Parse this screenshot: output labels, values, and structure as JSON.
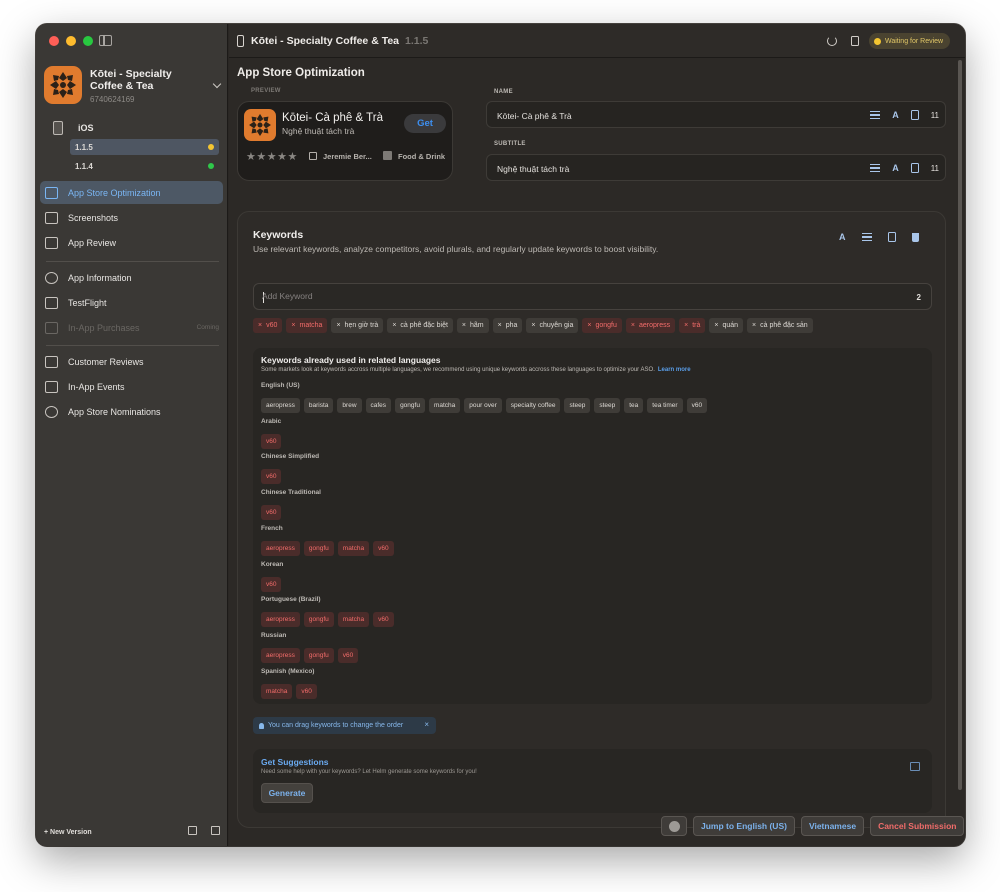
{
  "app": {
    "name": "Kōtei - Specialty Coffee & Tea",
    "id": "6740624169",
    "version": "1.1.5",
    "status": "Waiting for Review"
  },
  "sidebar": {
    "platform": "iOS",
    "versions": [
      {
        "label": "1.1.5",
        "dot": "#f3c531"
      },
      {
        "label": "1.1.4",
        "dot": "#2fc84a"
      }
    ],
    "nav": [
      {
        "label": "App Store Optimization",
        "icon": "magnifier-icon"
      },
      {
        "label": "Screenshots",
        "icon": "screenshots-icon"
      },
      {
        "label": "App Review",
        "icon": "app-review-icon"
      },
      {
        "label": "App Information",
        "icon": "info-icon"
      },
      {
        "label": "TestFlight",
        "icon": "testflight-icon"
      },
      {
        "label": "In-App Purchases",
        "icon": "purchases-icon",
        "badge": "Coming"
      },
      {
        "label": "Customer Reviews",
        "icon": "star-icon"
      },
      {
        "label": "In-App Events",
        "icon": "calendar-icon"
      },
      {
        "label": "App Store Nominations",
        "icon": "nomination-icon"
      }
    ],
    "new_version": "+ New Version"
  },
  "main": {
    "section_title": "App Store Optimization",
    "preview": {
      "label": "PREVIEW",
      "name": "Kōtei- Cà phê & Trà",
      "subtitle": "Nghệ thuật tách trà",
      "get": "Get",
      "stars": "★★★★★",
      "developer": "Jeremie Ber...",
      "category": "Food & Drink"
    },
    "name_field": {
      "label": "NAME",
      "value": "Kōtei- Cà phê & Trà",
      "count": "11"
    },
    "subtitle_field": {
      "label": "SUBTITLE",
      "value": "Nghệ thuật tách trà",
      "count": "11"
    },
    "keywords": {
      "title": "Keywords",
      "description": "Use relevant keywords, analyze competitors, avoid plurals, and regularly update keywords to boost visibility.",
      "placeholder": "Add Keyword",
      "count": "2",
      "chips": [
        {
          "label": "v60",
          "red": true
        },
        {
          "label": "matcha",
          "red": true
        },
        {
          "label": "hẹn giờ trà",
          "red": false
        },
        {
          "label": "cà phê đặc biệt",
          "red": false
        },
        {
          "label": "hãm",
          "red": false
        },
        {
          "label": "pha",
          "red": false
        },
        {
          "label": "chuyên gia",
          "red": false
        },
        {
          "label": "gongfu",
          "red": true
        },
        {
          "label": "aeropress",
          "red": true
        },
        {
          "label": "trà",
          "red": true
        },
        {
          "label": "quán",
          "red": false
        },
        {
          "label": "cà phê đặc sản",
          "red": false
        }
      ]
    },
    "used": {
      "title": "Keywords already used in related languages",
      "description": "Some markets look at keywords accross multiple languages, we recommend using unique keywords accross these languages to optimize your ASO.",
      "learn_more": "Learn more",
      "languages": [
        {
          "name": "English (US)",
          "red": false,
          "keywords": [
            "aeropress",
            "barista",
            "brew",
            "cafes",
            "gongfu",
            "matcha",
            "pour over",
            "specialty coffee",
            "steep",
            "steep",
            "tea",
            "tea timer",
            "v60"
          ]
        },
        {
          "name": "Arabic",
          "red": true,
          "keywords": [
            "v60"
          ]
        },
        {
          "name": "Chinese Simplified",
          "red": true,
          "keywords": [
            "v60"
          ]
        },
        {
          "name": "Chinese Traditional",
          "red": true,
          "keywords": [
            "v60"
          ]
        },
        {
          "name": "French",
          "red": true,
          "keywords": [
            "aeropress",
            "gongfu",
            "matcha",
            "v60"
          ]
        },
        {
          "name": "Korean",
          "red": true,
          "keywords": [
            "v60"
          ]
        },
        {
          "name": "Portuguese (Brazil)",
          "red": true,
          "keywords": [
            "aeropress",
            "gongfu",
            "matcha",
            "v60"
          ]
        },
        {
          "name": "Russian",
          "red": true,
          "keywords": [
            "aeropress",
            "gongfu",
            "v60"
          ]
        },
        {
          "name": "Spanish (Mexico)",
          "red": true,
          "keywords": [
            "matcha",
            "v60"
          ]
        }
      ]
    },
    "drag_hint": "You can drag keywords to change the order",
    "suggestions": {
      "title": "Get Suggestions",
      "description": "Need some help with your keywords? Let Helm generate some keywords for you!",
      "button": "Generate"
    }
  },
  "bottom_bar": {
    "jump": "Jump to English (US)",
    "language": "Vietnamese",
    "cancel": "Cancel Submission"
  }
}
